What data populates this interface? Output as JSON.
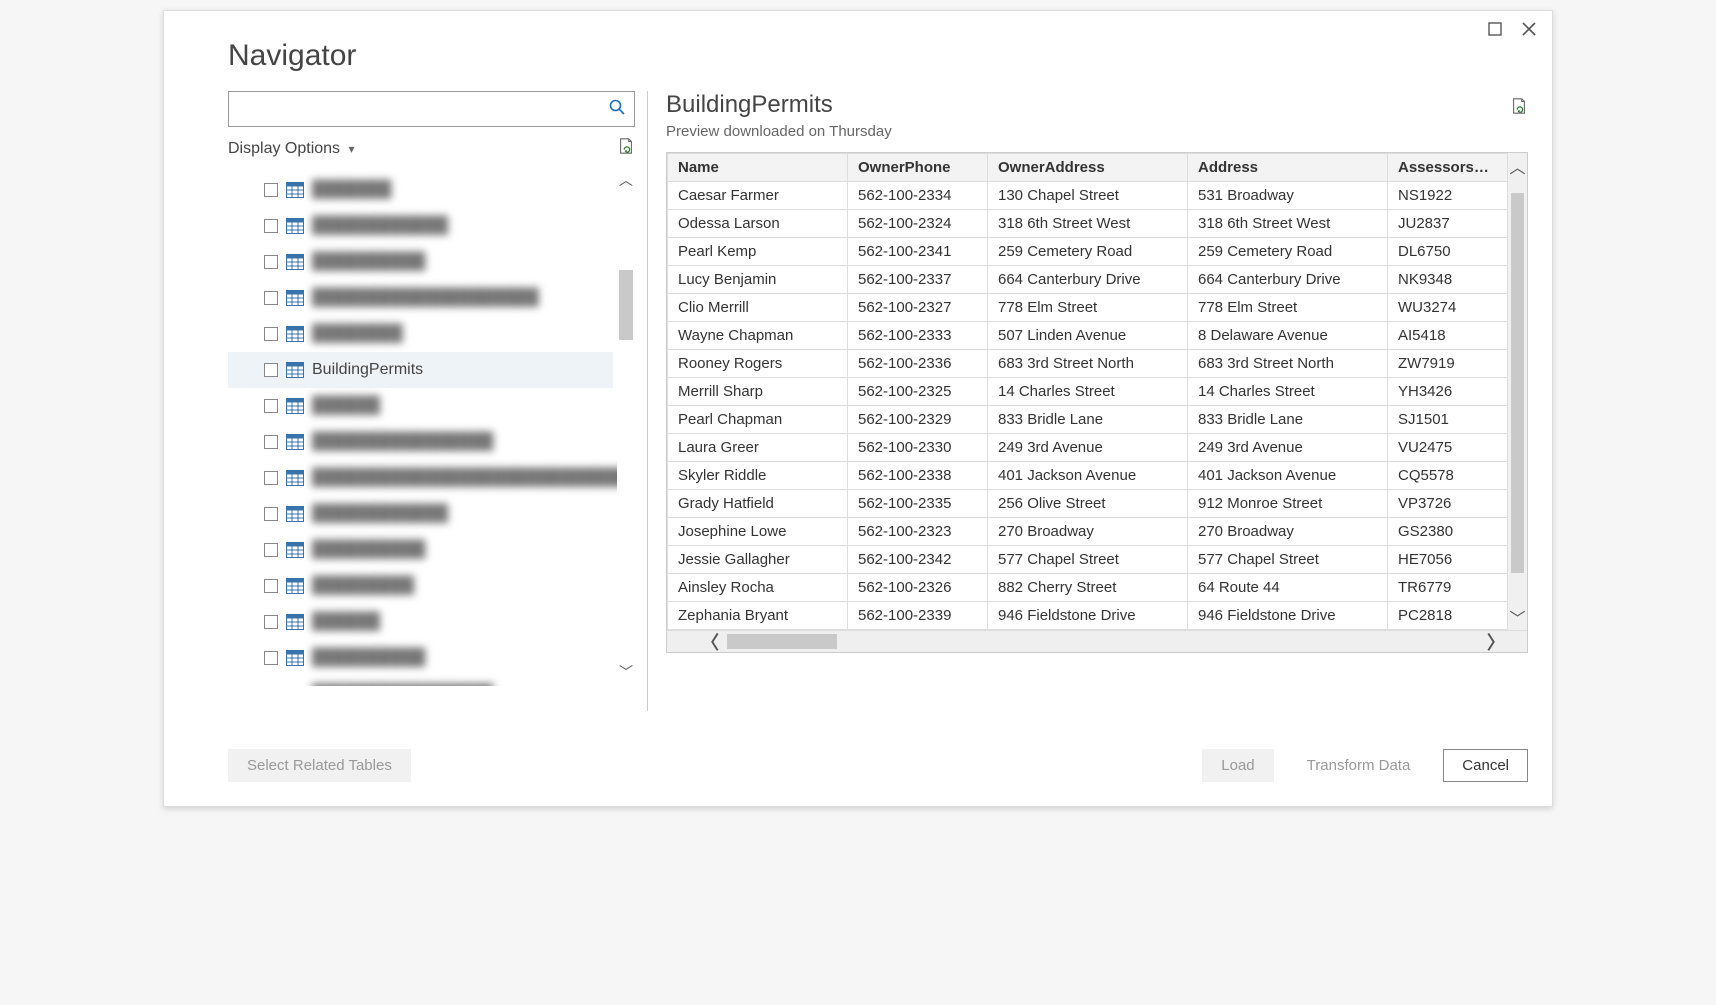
{
  "window": {
    "title": "Navigator"
  },
  "sidebar": {
    "search_placeholder": "",
    "display_options_label": "Display Options",
    "items": [
      {
        "label": "███████",
        "blurred": true
      },
      {
        "label": "████████████",
        "blurred": true
      },
      {
        "label": "██████████",
        "blurred": true
      },
      {
        "label": "████████████████████",
        "blurred": true
      },
      {
        "label": "████████",
        "blurred": true
      },
      {
        "label": "BuildingPermits",
        "blurred": false,
        "selected": true
      },
      {
        "label": "██████",
        "blurred": true
      },
      {
        "label": "████████████████",
        "blurred": true
      },
      {
        "label": "████████████████████████████",
        "blurred": true
      },
      {
        "label": "████████████",
        "blurred": true
      },
      {
        "label": "██████████",
        "blurred": true
      },
      {
        "label": "█████████",
        "blurred": true
      },
      {
        "label": "██████",
        "blurred": true
      },
      {
        "label": "██████████",
        "blurred": true
      },
      {
        "label": "████████████████",
        "blurred": true
      }
    ]
  },
  "preview": {
    "title": "BuildingPermits",
    "subtitle": "Preview downloaded on Thursday",
    "columns": [
      "Name",
      "OwnerPhone",
      "OwnerAddress",
      "Address",
      "AssessorsParcel"
    ],
    "rows": [
      {
        "Name": "Caesar Farmer",
        "OwnerPhone": "562-100-2334",
        "OwnerAddress": "130 Chapel Street",
        "Address": "531 Broadway",
        "AssessorsParcel": "NS1922"
      },
      {
        "Name": "Odessa Larson",
        "OwnerPhone": "562-100-2324",
        "OwnerAddress": "318 6th Street West",
        "Address": "318 6th Street West",
        "AssessorsParcel": "JU2837"
      },
      {
        "Name": "Pearl Kemp",
        "OwnerPhone": "562-100-2341",
        "OwnerAddress": "259 Cemetery Road",
        "Address": "259 Cemetery Road",
        "AssessorsParcel": "DL6750"
      },
      {
        "Name": "Lucy Benjamin",
        "OwnerPhone": "562-100-2337",
        "OwnerAddress": "664 Canterbury Drive",
        "Address": "664 Canterbury Drive",
        "AssessorsParcel": "NK9348"
      },
      {
        "Name": "Clio Merrill",
        "OwnerPhone": "562-100-2327",
        "OwnerAddress": "778 Elm Street",
        "Address": "778 Elm Street",
        "AssessorsParcel": "WU3274"
      },
      {
        "Name": "Wayne Chapman",
        "OwnerPhone": "562-100-2333",
        "OwnerAddress": "507 Linden Avenue",
        "Address": "8 Delaware Avenue",
        "AssessorsParcel": "AI5418"
      },
      {
        "Name": "Rooney Rogers",
        "OwnerPhone": "562-100-2336",
        "OwnerAddress": "683 3rd Street North",
        "Address": "683 3rd Street North",
        "AssessorsParcel": "ZW7919"
      },
      {
        "Name": "Merrill Sharp",
        "OwnerPhone": "562-100-2325",
        "OwnerAddress": "14 Charles Street",
        "Address": "14 Charles Street",
        "AssessorsParcel": "YH3426"
      },
      {
        "Name": "Pearl Chapman",
        "OwnerPhone": "562-100-2329",
        "OwnerAddress": "833 Bridle Lane",
        "Address": "833 Bridle Lane",
        "AssessorsParcel": "SJ1501"
      },
      {
        "Name": "Laura Greer",
        "OwnerPhone": "562-100-2330",
        "OwnerAddress": "249 3rd Avenue",
        "Address": "249 3rd Avenue",
        "AssessorsParcel": "VU2475"
      },
      {
        "Name": "Skyler Riddle",
        "OwnerPhone": "562-100-2338",
        "OwnerAddress": "401 Jackson Avenue",
        "Address": "401 Jackson Avenue",
        "AssessorsParcel": "CQ5578"
      },
      {
        "Name": "Grady Hatfield",
        "OwnerPhone": "562-100-2335",
        "OwnerAddress": "256 Olive Street",
        "Address": "912 Monroe Street",
        "AssessorsParcel": "VP3726"
      },
      {
        "Name": "Josephine Lowe",
        "OwnerPhone": "562-100-2323",
        "OwnerAddress": "270 Broadway",
        "Address": "270 Broadway",
        "AssessorsParcel": "GS2380"
      },
      {
        "Name": "Jessie Gallagher",
        "OwnerPhone": "562-100-2342",
        "OwnerAddress": "577 Chapel Street",
        "Address": "577 Chapel Street",
        "AssessorsParcel": "HE7056"
      },
      {
        "Name": "Ainsley Rocha",
        "OwnerPhone": "562-100-2326",
        "OwnerAddress": "882 Cherry Street",
        "Address": "64 Route 44",
        "AssessorsParcel": "TR6779"
      },
      {
        "Name": "Zephania Bryant",
        "OwnerPhone": "562-100-2339",
        "OwnerAddress": "946 Fieldstone Drive",
        "Address": "946 Fieldstone Drive",
        "AssessorsParcel": "PC2818"
      }
    ]
  },
  "footer": {
    "select_related": "Select Related Tables",
    "load": "Load",
    "transform": "Transform Data",
    "cancel": "Cancel"
  }
}
